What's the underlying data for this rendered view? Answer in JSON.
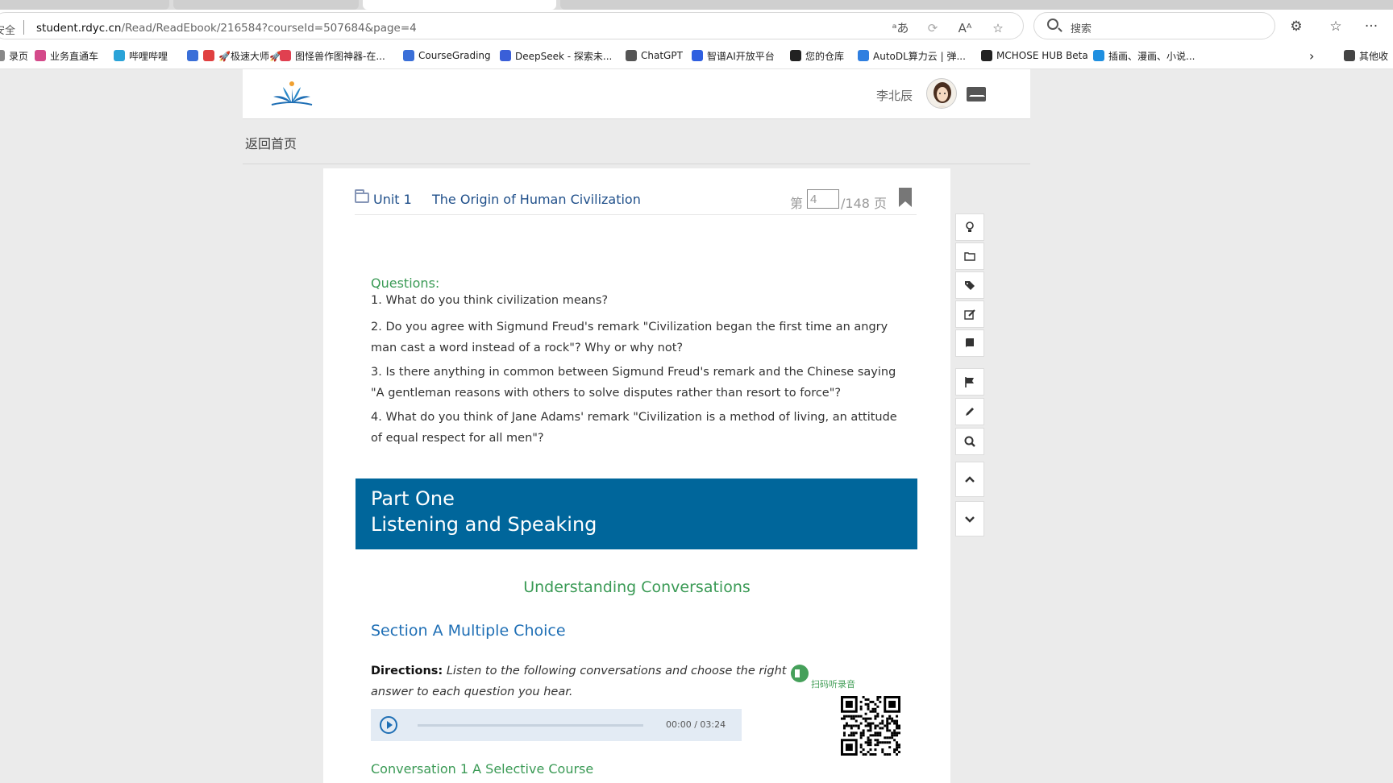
{
  "browser": {
    "security_label": "安全",
    "url_host": "student.rdyc.cn",
    "url_path": "/Read/ReadEbook/216584?courseId=507684&page=4",
    "search_placeholder": "搜索"
  },
  "bookmarks": [
    {
      "label": "录页",
      "icon": "page-icon",
      "color": "#888888"
    },
    {
      "label": "业务直通车",
      "icon": "link-icon",
      "color": "#d44a8a"
    },
    {
      "label": "哔哩哔哩",
      "icon": "bilibili-icon",
      "color": "#2aa3d8"
    },
    {
      "label": "",
      "icon": "rocket-icon",
      "color": "#3a6fd8"
    },
    {
      "label": "🚀极速大师🚀",
      "icon": "rocket-icon",
      "color": "#e04040"
    },
    {
      "label": "图怪兽作图神器-在...",
      "icon": "image-icon",
      "color": "#e04050"
    },
    {
      "label": "CourseGrading",
      "icon": "cg-icon",
      "color": "#3a6fd8"
    },
    {
      "label": "DeepSeek - 探索未...",
      "icon": "deepseek-icon",
      "color": "#3a5fd8"
    },
    {
      "label": "ChatGPT",
      "icon": "chatgpt-icon",
      "color": "#555555"
    },
    {
      "label": "智谱AI开放平台",
      "icon": "zhipu-icon",
      "color": "#2f5fe0"
    },
    {
      "label": "您的仓库",
      "icon": "github-icon",
      "color": "#222222"
    },
    {
      "label": "AutoDL算力云 | 弹...",
      "icon": "autodl-icon",
      "color": "#2f7fe0"
    },
    {
      "label": "MCHOSE HUB Beta",
      "icon": "mchose-icon",
      "color": "#222222"
    },
    {
      "label": "插画、漫画、小说...",
      "icon": "pixiv-icon",
      "color": "#1f8fe0"
    },
    {
      "label": "其他收",
      "icon": "folder-icon",
      "color": "#444444"
    }
  ],
  "site": {
    "username": "李北辰",
    "back_link": "返回首页"
  },
  "reader": {
    "unit": "Unit 1",
    "unit_title": "The Origin of Human Civilization",
    "page_prefix": "第",
    "page_current": "4",
    "page_total": "/148 页"
  },
  "content": {
    "questions_heading": "Questions:",
    "questions": [
      "1. What do you think civilization means?",
      "2. Do you agree with Sigmund Freud's remark \"Civilization began the first time an angry man cast a word instead of a rock\"? Why or why not?",
      "3. Is there anything in common between Sigmund Freud's remark and the Chinese saying \"A gentleman reasons with others to solve disputes rather than resort to force\"?",
      "4. What do you think of Jane Adams' remark \"Civilization is a method of living, an attitude of equal respect for all men\"?"
    ],
    "part_line1": "Part One",
    "part_line2": "Listening and Speaking",
    "understanding": "Understanding Conversations",
    "section_a": "Section A Multiple Choice",
    "directions_label": "Directions:",
    "directions_text": "Listen to the following conversations and choose the right answer to each question you hear.",
    "audio_time": "00:00 / 03:24",
    "audio_progress": 0,
    "scan_label": "扫码听录音",
    "conversation1": "Conversation 1 A Selective Course"
  },
  "side_tools": [
    {
      "name": "tip-tool-button",
      "icon": "lightbulb-icon"
    },
    {
      "name": "catalog-tool-button",
      "icon": "folder-icon"
    },
    {
      "name": "tags-tool-button",
      "icon": "tags-icon"
    },
    {
      "name": "note-tool-button",
      "icon": "edit-icon"
    },
    {
      "name": "book-tool-button",
      "icon": "book-icon"
    },
    {
      "name": "flag-tool-button",
      "icon": "flag-icon"
    },
    {
      "name": "pencil-tool-button",
      "icon": "pencil-icon"
    },
    {
      "name": "search-tool-button",
      "icon": "search-icon"
    },
    {
      "name": "scroll-up-button",
      "icon": "chevron-up-icon"
    },
    {
      "name": "scroll-down-button",
      "icon": "chevron-down-icon"
    }
  ],
  "colors": {
    "banner": "#00669b",
    "green": "#3a9a55",
    "blue": "#1f6fb5"
  }
}
